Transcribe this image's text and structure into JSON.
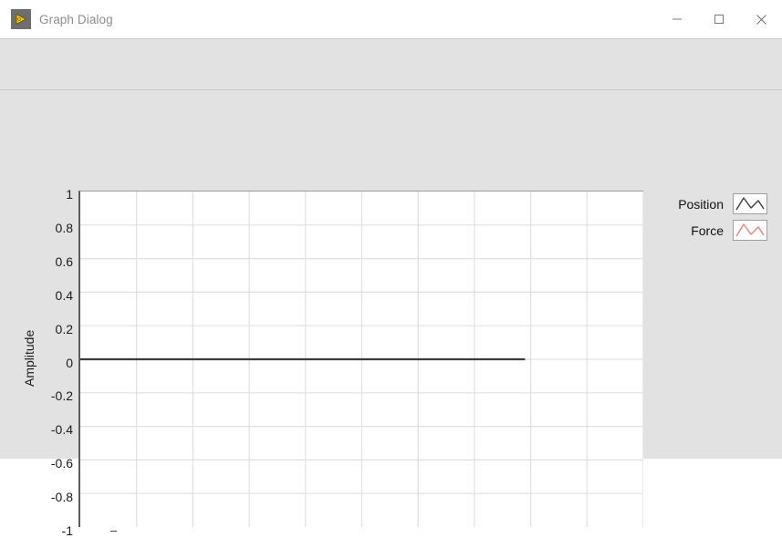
{
  "window": {
    "title": "Graph Dialog",
    "icon": "labview-run-arrow-icon",
    "controls": {
      "minimize": "minimize-icon",
      "maximize": "maximize-icon",
      "close": "close-icon"
    }
  },
  "toolbar": {
    "items": []
  },
  "chart_data": {
    "type": "line",
    "title": "",
    "xlabel": "",
    "ylabel": "Amplitude",
    "ylim": [
      -1,
      1
    ],
    "yticks": [
      1,
      0.8,
      0.6,
      0.4,
      0.2,
      0,
      -0.2,
      -0.4,
      -0.6,
      -0.8,
      -1
    ],
    "ytick_labels": [
      "1",
      "0.8",
      "0.6",
      "0.4",
      "0.2",
      "0",
      "-0.2",
      "-0.4",
      "-0.6",
      "-0.8",
      "-1"
    ],
    "xlim": [
      0,
      10
    ],
    "xticks": [
      0,
      1,
      2,
      3,
      4,
      5,
      6,
      7,
      8,
      9,
      10
    ],
    "xtick_labels": [
      "",
      "",
      "",
      "",
      "",
      "",
      "",
      "",
      "",
      "",
      ""
    ],
    "grid": true,
    "grid_color": "#e0e0e0",
    "plot_background": "#ffffff",
    "legend_position": "right",
    "series": [
      {
        "name": "Position",
        "color": "#3c3c3c",
        "x": [
          0,
          7.9
        ],
        "values": [
          0,
          0
        ]
      },
      {
        "name": "Force",
        "color": "#f08080",
        "x": [],
        "values": []
      }
    ]
  },
  "legend": {
    "entries": [
      {
        "label": "Position",
        "color": "#3c3c3c",
        "swatch": "plot-line-swatch"
      },
      {
        "label": "Force",
        "color": "#f08080",
        "swatch": "plot-line-swatch"
      }
    ]
  },
  "colors": {
    "window_background": "#e2e2e2",
    "titlebar_background": "#ffffff",
    "title_text": "#8d8d8d",
    "axis": "#5c5c5c",
    "text": "#1b1b1b",
    "icon_accent": "#ffcc00"
  }
}
